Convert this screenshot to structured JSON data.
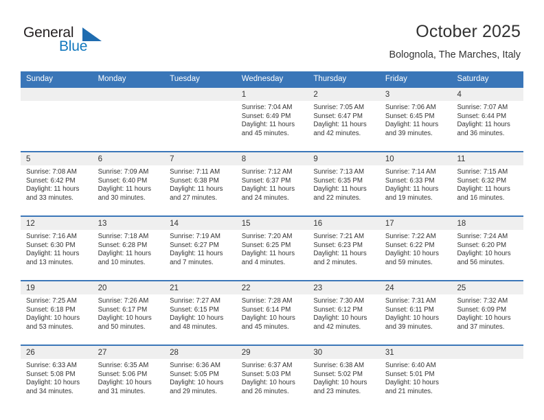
{
  "brand": {
    "name_top": "General",
    "name_bottom": "Blue",
    "triangle_color": "#1f6cb0",
    "blue_text_color": "#1278be"
  },
  "header": {
    "title": "October 2025",
    "subtitle": "Bolognola, The Marches, Italy"
  },
  "colors": {
    "header_blue": "#3a76b8",
    "daynum_band": "#efefef",
    "text": "#333333"
  },
  "weekday_headers": [
    "Sunday",
    "Monday",
    "Tuesday",
    "Wednesday",
    "Thursday",
    "Friday",
    "Saturday"
  ],
  "weeks": [
    [
      {
        "day": ""
      },
      {
        "day": ""
      },
      {
        "day": ""
      },
      {
        "day": "1",
        "sunrise": "Sunrise: 7:04 AM",
        "sunset": "Sunset: 6:49 PM",
        "daylight1": "Daylight: 11 hours",
        "daylight2": "and 45 minutes."
      },
      {
        "day": "2",
        "sunrise": "Sunrise: 7:05 AM",
        "sunset": "Sunset: 6:47 PM",
        "daylight1": "Daylight: 11 hours",
        "daylight2": "and 42 minutes."
      },
      {
        "day": "3",
        "sunrise": "Sunrise: 7:06 AM",
        "sunset": "Sunset: 6:45 PM",
        "daylight1": "Daylight: 11 hours",
        "daylight2": "and 39 minutes."
      },
      {
        "day": "4",
        "sunrise": "Sunrise: 7:07 AM",
        "sunset": "Sunset: 6:44 PM",
        "daylight1": "Daylight: 11 hours",
        "daylight2": "and 36 minutes."
      }
    ],
    [
      {
        "day": "5",
        "sunrise": "Sunrise: 7:08 AM",
        "sunset": "Sunset: 6:42 PM",
        "daylight1": "Daylight: 11 hours",
        "daylight2": "and 33 minutes."
      },
      {
        "day": "6",
        "sunrise": "Sunrise: 7:09 AM",
        "sunset": "Sunset: 6:40 PM",
        "daylight1": "Daylight: 11 hours",
        "daylight2": "and 30 minutes."
      },
      {
        "day": "7",
        "sunrise": "Sunrise: 7:11 AM",
        "sunset": "Sunset: 6:38 PM",
        "daylight1": "Daylight: 11 hours",
        "daylight2": "and 27 minutes."
      },
      {
        "day": "8",
        "sunrise": "Sunrise: 7:12 AM",
        "sunset": "Sunset: 6:37 PM",
        "daylight1": "Daylight: 11 hours",
        "daylight2": "and 24 minutes."
      },
      {
        "day": "9",
        "sunrise": "Sunrise: 7:13 AM",
        "sunset": "Sunset: 6:35 PM",
        "daylight1": "Daylight: 11 hours",
        "daylight2": "and 22 minutes."
      },
      {
        "day": "10",
        "sunrise": "Sunrise: 7:14 AM",
        "sunset": "Sunset: 6:33 PM",
        "daylight1": "Daylight: 11 hours",
        "daylight2": "and 19 minutes."
      },
      {
        "day": "11",
        "sunrise": "Sunrise: 7:15 AM",
        "sunset": "Sunset: 6:32 PM",
        "daylight1": "Daylight: 11 hours",
        "daylight2": "and 16 minutes."
      }
    ],
    [
      {
        "day": "12",
        "sunrise": "Sunrise: 7:16 AM",
        "sunset": "Sunset: 6:30 PM",
        "daylight1": "Daylight: 11 hours",
        "daylight2": "and 13 minutes."
      },
      {
        "day": "13",
        "sunrise": "Sunrise: 7:18 AM",
        "sunset": "Sunset: 6:28 PM",
        "daylight1": "Daylight: 11 hours",
        "daylight2": "and 10 minutes."
      },
      {
        "day": "14",
        "sunrise": "Sunrise: 7:19 AM",
        "sunset": "Sunset: 6:27 PM",
        "daylight1": "Daylight: 11 hours",
        "daylight2": "and 7 minutes."
      },
      {
        "day": "15",
        "sunrise": "Sunrise: 7:20 AM",
        "sunset": "Sunset: 6:25 PM",
        "daylight1": "Daylight: 11 hours",
        "daylight2": "and 4 minutes."
      },
      {
        "day": "16",
        "sunrise": "Sunrise: 7:21 AM",
        "sunset": "Sunset: 6:23 PM",
        "daylight1": "Daylight: 11 hours",
        "daylight2": "and 2 minutes."
      },
      {
        "day": "17",
        "sunrise": "Sunrise: 7:22 AM",
        "sunset": "Sunset: 6:22 PM",
        "daylight1": "Daylight: 10 hours",
        "daylight2": "and 59 minutes."
      },
      {
        "day": "18",
        "sunrise": "Sunrise: 7:24 AM",
        "sunset": "Sunset: 6:20 PM",
        "daylight1": "Daylight: 10 hours",
        "daylight2": "and 56 minutes."
      }
    ],
    [
      {
        "day": "19",
        "sunrise": "Sunrise: 7:25 AM",
        "sunset": "Sunset: 6:18 PM",
        "daylight1": "Daylight: 10 hours",
        "daylight2": "and 53 minutes."
      },
      {
        "day": "20",
        "sunrise": "Sunrise: 7:26 AM",
        "sunset": "Sunset: 6:17 PM",
        "daylight1": "Daylight: 10 hours",
        "daylight2": "and 50 minutes."
      },
      {
        "day": "21",
        "sunrise": "Sunrise: 7:27 AM",
        "sunset": "Sunset: 6:15 PM",
        "daylight1": "Daylight: 10 hours",
        "daylight2": "and 48 minutes."
      },
      {
        "day": "22",
        "sunrise": "Sunrise: 7:28 AM",
        "sunset": "Sunset: 6:14 PM",
        "daylight1": "Daylight: 10 hours",
        "daylight2": "and 45 minutes."
      },
      {
        "day": "23",
        "sunrise": "Sunrise: 7:30 AM",
        "sunset": "Sunset: 6:12 PM",
        "daylight1": "Daylight: 10 hours",
        "daylight2": "and 42 minutes."
      },
      {
        "day": "24",
        "sunrise": "Sunrise: 7:31 AM",
        "sunset": "Sunset: 6:11 PM",
        "daylight1": "Daylight: 10 hours",
        "daylight2": "and 39 minutes."
      },
      {
        "day": "25",
        "sunrise": "Sunrise: 7:32 AM",
        "sunset": "Sunset: 6:09 PM",
        "daylight1": "Daylight: 10 hours",
        "daylight2": "and 37 minutes."
      }
    ],
    [
      {
        "day": "26",
        "sunrise": "Sunrise: 6:33 AM",
        "sunset": "Sunset: 5:08 PM",
        "daylight1": "Daylight: 10 hours",
        "daylight2": "and 34 minutes."
      },
      {
        "day": "27",
        "sunrise": "Sunrise: 6:35 AM",
        "sunset": "Sunset: 5:06 PM",
        "daylight1": "Daylight: 10 hours",
        "daylight2": "and 31 minutes."
      },
      {
        "day": "28",
        "sunrise": "Sunrise: 6:36 AM",
        "sunset": "Sunset: 5:05 PM",
        "daylight1": "Daylight: 10 hours",
        "daylight2": "and 29 minutes."
      },
      {
        "day": "29",
        "sunrise": "Sunrise: 6:37 AM",
        "sunset": "Sunset: 5:03 PM",
        "daylight1": "Daylight: 10 hours",
        "daylight2": "and 26 minutes."
      },
      {
        "day": "30",
        "sunrise": "Sunrise: 6:38 AM",
        "sunset": "Sunset: 5:02 PM",
        "daylight1": "Daylight: 10 hours",
        "daylight2": "and 23 minutes."
      },
      {
        "day": "31",
        "sunrise": "Sunrise: 6:40 AM",
        "sunset": "Sunset: 5:01 PM",
        "daylight1": "Daylight: 10 hours",
        "daylight2": "and 21 minutes."
      },
      {
        "day": ""
      }
    ]
  ]
}
